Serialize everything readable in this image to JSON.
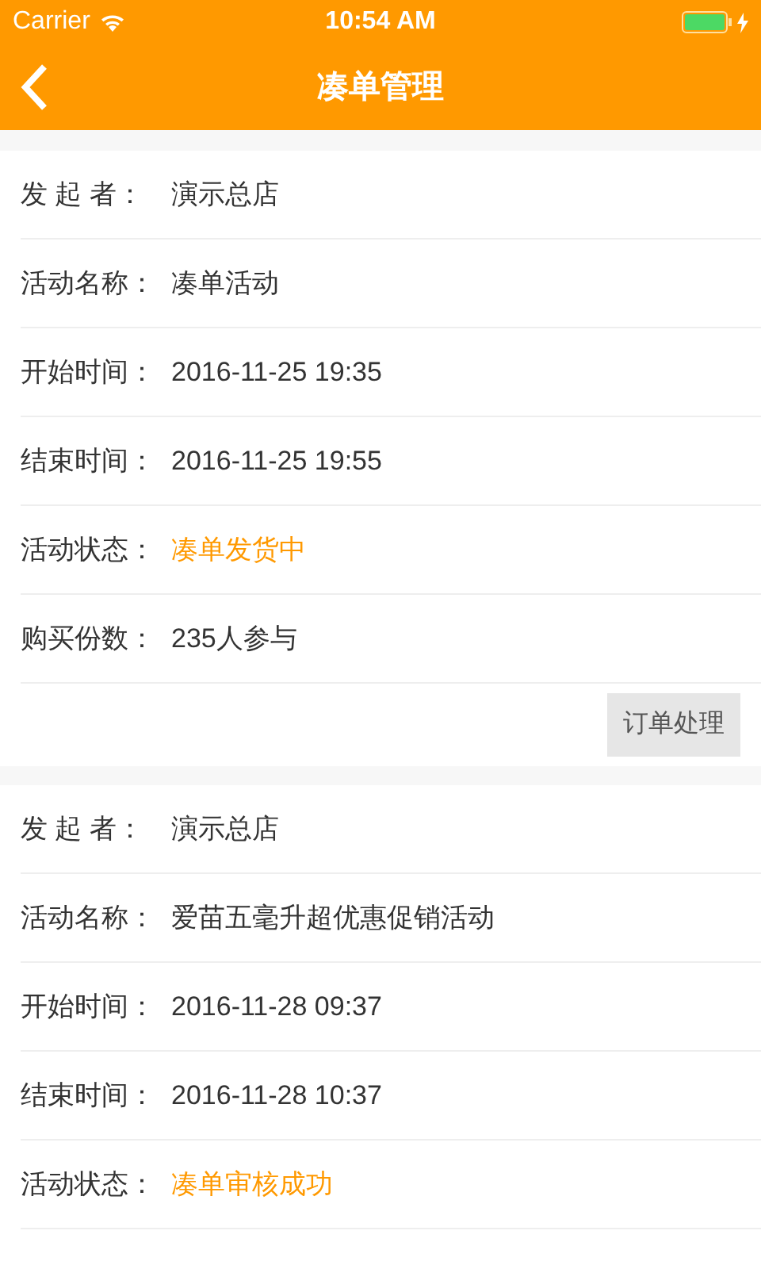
{
  "status_bar": {
    "carrier": "Carrier",
    "time": "10:54 AM"
  },
  "nav": {
    "title": "凑单管理"
  },
  "cards": [
    {
      "rows": [
        {
          "label": "发 起 者：",
          "value": "演示总店",
          "kind": "text"
        },
        {
          "label": "活动名称：",
          "value": "凑单活动",
          "kind": "text"
        },
        {
          "label": "开始时间：",
          "value": "2016-11-25 19:35",
          "kind": "text"
        },
        {
          "label": "结束时间：",
          "value": "2016-11-25 19:55",
          "kind": "text"
        },
        {
          "label": "活动状态：",
          "value": "凑单发货中",
          "kind": "status"
        },
        {
          "label": "购买份数：",
          "value": "235人参与",
          "kind": "text"
        }
      ],
      "button": "订单处理"
    },
    {
      "rows": [
        {
          "label": "发 起 者：",
          "value": "演示总店",
          "kind": "text"
        },
        {
          "label": "活动名称：",
          "value": "爱苗五毫升超优惠促销活动",
          "kind": "text"
        },
        {
          "label": "开始时间：",
          "value": "2016-11-28 09:37",
          "kind": "text"
        },
        {
          "label": "结束时间：",
          "value": "2016-11-28 10:37",
          "kind": "text"
        },
        {
          "label": "活动状态：",
          "value": "凑单审核成功",
          "kind": "status"
        }
      ]
    }
  ]
}
